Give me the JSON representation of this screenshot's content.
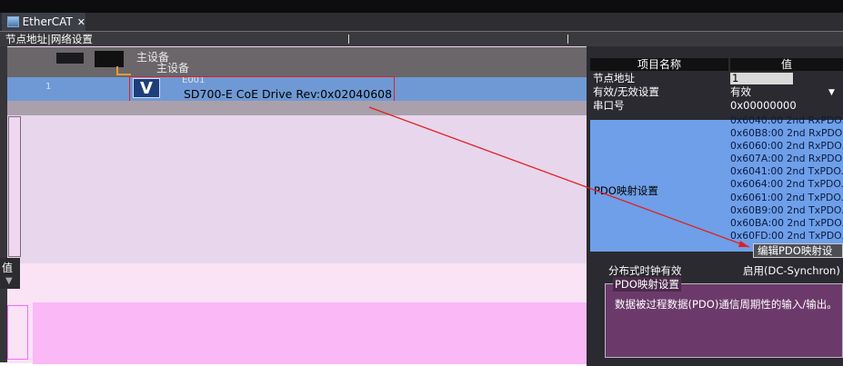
{
  "window": {
    "tab_title": "EtherCAT",
    "tab_close": "✕",
    "menu_text": "节点地址|网络设置"
  },
  "tree": {
    "master_label_1": "主设备",
    "master_label_2": "主设备",
    "row_number": "1",
    "device_code": "E001",
    "device_icon_letter": "V",
    "device_name": "SD700-E CoE Drive Rev:0x02040608"
  },
  "left_side": {
    "mark_label": "值",
    "mark_arrow": "▼"
  },
  "properties": {
    "header_name": "项目名称",
    "header_value": "值",
    "rows": [
      {
        "key": "节点地址",
        "value": "1"
      },
      {
        "key": "有效/无效设置",
        "value": "有效"
      },
      {
        "key": "串口号",
        "value": "0x00000000"
      }
    ],
    "pdo_label": "PDO映射设置",
    "pdo_entries": [
      "0x6040:00 2nd RxPDO..",
      "0x60B8:00 2nd RxPDO..",
      "0x6060:00 2nd RxPDO..",
      "0x607A:00 2nd RxPDO..",
      "0x6041:00 2nd TxPDO..",
      "0x6064:00 2nd TxPDO..",
      "0x6061:00 2nd TxPDO..",
      "0x60B9:00 2nd TxPDO..",
      "0x60BA:00 2nd TxPDO..",
      "0x60FD:00 2nd TxPDO.."
    ],
    "edit_button": "编辑PDO映射设",
    "dc_key": "分布式时钟有效",
    "dc_value": "启用(DC-Synchron)",
    "desc_title": "PDO映射设置",
    "desc_body": "数据被过程数据(PDO)通信周期性的输入/输出。"
  },
  "colors": {
    "selection": "#6e99d4",
    "annotation": "#e02020",
    "pdo_highlight": "#6e9fe8"
  }
}
